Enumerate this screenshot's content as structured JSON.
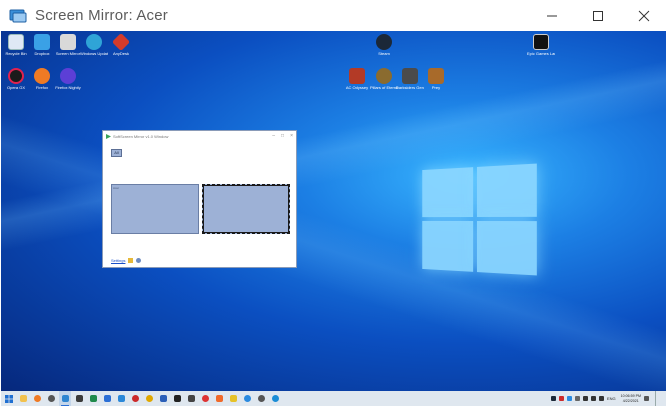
{
  "window": {
    "title": "Screen Mirror: Acer"
  },
  "desktop": {
    "icons_left": [
      {
        "label": "Recycle Bin",
        "icon": "recycle-bin-icon",
        "color": "#dfe8f5"
      },
      {
        "label": "Dropbox",
        "icon": "folder-shortcut-icon",
        "color": "#3aa1e6"
      },
      {
        "label": "Screen Mirror",
        "icon": "file-shortcut-icon",
        "color": "#d9d9d9"
      },
      {
        "label": "Windows Update",
        "icon": "network-icon",
        "color": "#2fa4d7"
      },
      {
        "label": "AnyDesk",
        "icon": "anydesk-icon",
        "color": "#d23b2b"
      },
      {
        "label": "Opera GX",
        "icon": "opera-gx-icon",
        "color": "#1b1b1b"
      },
      {
        "label": "Firefox",
        "icon": "firefox-icon",
        "color": "#ef7a24"
      },
      {
        "label": "Firefox Nightly",
        "icon": "firefox-nightly-icon",
        "color": "#5c3fd6"
      }
    ],
    "icons_center": [
      {
        "label": "Steam",
        "icon": "steam-icon",
        "color": "#1b2838"
      },
      {
        "label": "AC Odyssey",
        "icon": "game-icon-1",
        "color": "#b33a26"
      },
      {
        "label": "Pillars of Eternity II",
        "icon": "game-icon-2",
        "color": "#8a6b2f"
      },
      {
        "label": "Darksiders Genesis",
        "icon": "game-icon-3",
        "color": "#4b4b4b"
      },
      {
        "label": "Prey",
        "icon": "game-icon-4",
        "color": "#a86a2a"
      }
    ],
    "icons_right": [
      {
        "label": "Epic Games Launcher",
        "icon": "epic-games-icon",
        "color": "#111111"
      }
    ]
  },
  "app": {
    "title": "SoftScreen Mirror v1.0 Window",
    "all_button": "All",
    "monitor1_label": "Acer",
    "monitor2_label": "",
    "settings_link": "Settings"
  },
  "taskbar": {
    "apps": [
      {
        "icon": "file-explorer-icon",
        "color": "#f2c14e"
      },
      {
        "icon": "firefox-icon",
        "color": "#ef7a24"
      },
      {
        "icon": "app-icon-3",
        "color": "#555"
      },
      {
        "icon": "screen-mirror-icon",
        "color": "#2f86d1",
        "active": true
      },
      {
        "icon": "calculator-icon",
        "color": "#3a3a3a"
      },
      {
        "icon": "excel-icon",
        "color": "#1f8a4c"
      },
      {
        "icon": "photos-icon",
        "color": "#2b6fd6"
      },
      {
        "icon": "todo-icon",
        "color": "#2b88d8"
      },
      {
        "icon": "help-icon",
        "color": "#cc2a2a"
      },
      {
        "icon": "chrome-icon",
        "color": "#e0a800"
      },
      {
        "icon": "word-icon",
        "color": "#2b5fb8"
      },
      {
        "icon": "unity-icon",
        "color": "#222"
      },
      {
        "icon": "media-icon",
        "color": "#444"
      },
      {
        "icon": "vivaldi-icon",
        "color": "#d33"
      },
      {
        "icon": "brave-icon",
        "color": "#f06a2a"
      },
      {
        "icon": "notes-icon",
        "color": "#e6c229"
      },
      {
        "icon": "messenger-icon",
        "color": "#2a8ae0"
      },
      {
        "icon": "settings-icon",
        "color": "#555"
      },
      {
        "icon": "edge-icon",
        "color": "#1b8dd6"
      }
    ],
    "lang": "ENG",
    "time": "10:06:59 PM",
    "date": "4/22/2021"
  }
}
